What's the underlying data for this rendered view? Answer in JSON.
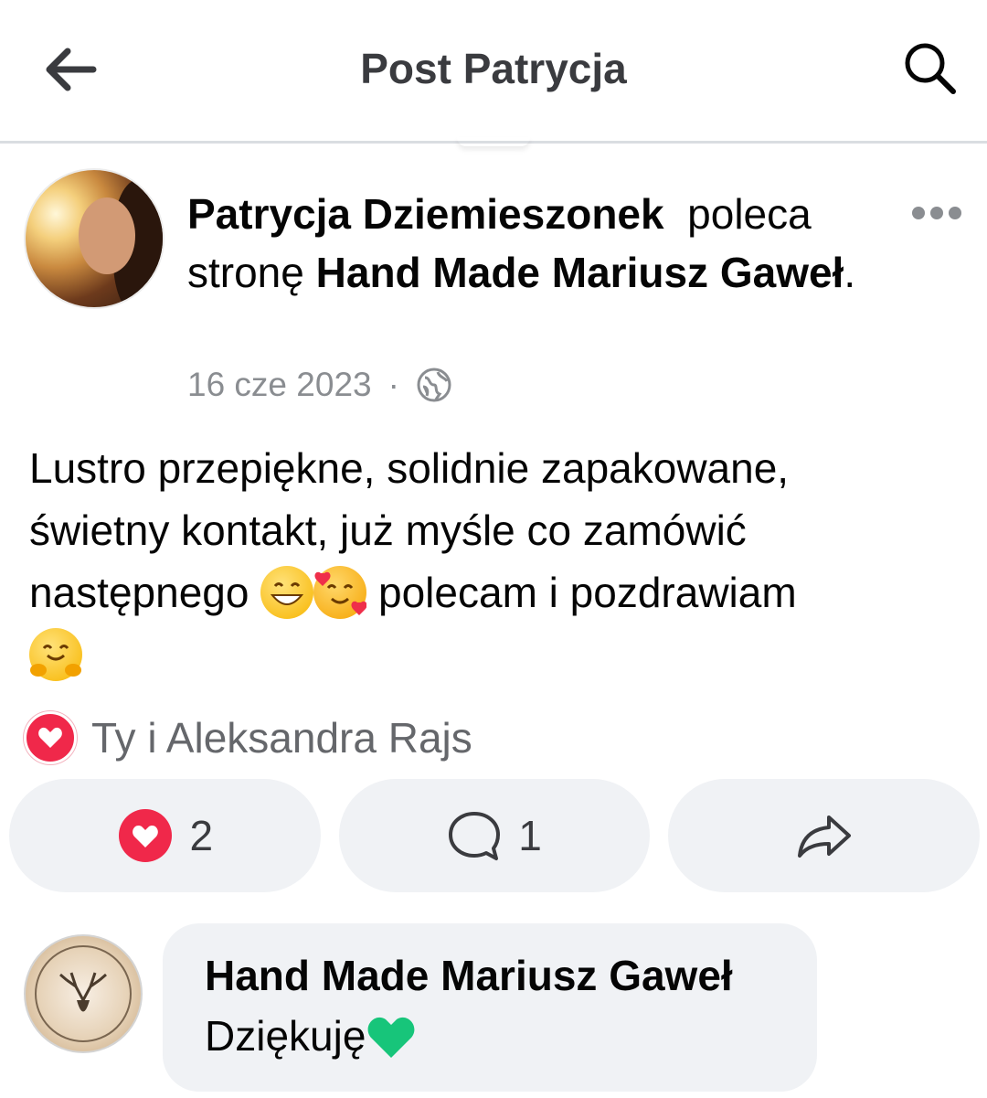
{
  "header": {
    "title": "Post Patrycja",
    "back_icon": "arrow-left-icon",
    "search_icon": "search-icon"
  },
  "post": {
    "author": "Patrycja Dziemieszonek",
    "action_word": "poleca",
    "action_word2": "stronę",
    "page_name": "Hand Made Mariusz Gaweł",
    "page_suffix": ".",
    "date": "16 cze 2023",
    "separator": "·",
    "privacy_icon": "globe-icon",
    "text_line1": "Lustro przepiękne, solidnie zapakowane,",
    "text_line2": "świetny kontakt, już myśle co zamówić",
    "text_line3_a": "następnego",
    "text_line3_b": "polecam i pozdrawiam",
    "emojis": [
      "grinning-face-emoji",
      "smiling-face-with-hearts-emoji",
      "hugging-face-emoji"
    ]
  },
  "reactions": {
    "summary": "Ty i Aleksandra Rajs",
    "love_count": "2",
    "comment_count": "1",
    "love_color": "#f0284a"
  },
  "comment": {
    "author": "Hand Made Mariusz Gaweł",
    "text": "Dziękuję",
    "emoji": "green-heart-emoji"
  }
}
